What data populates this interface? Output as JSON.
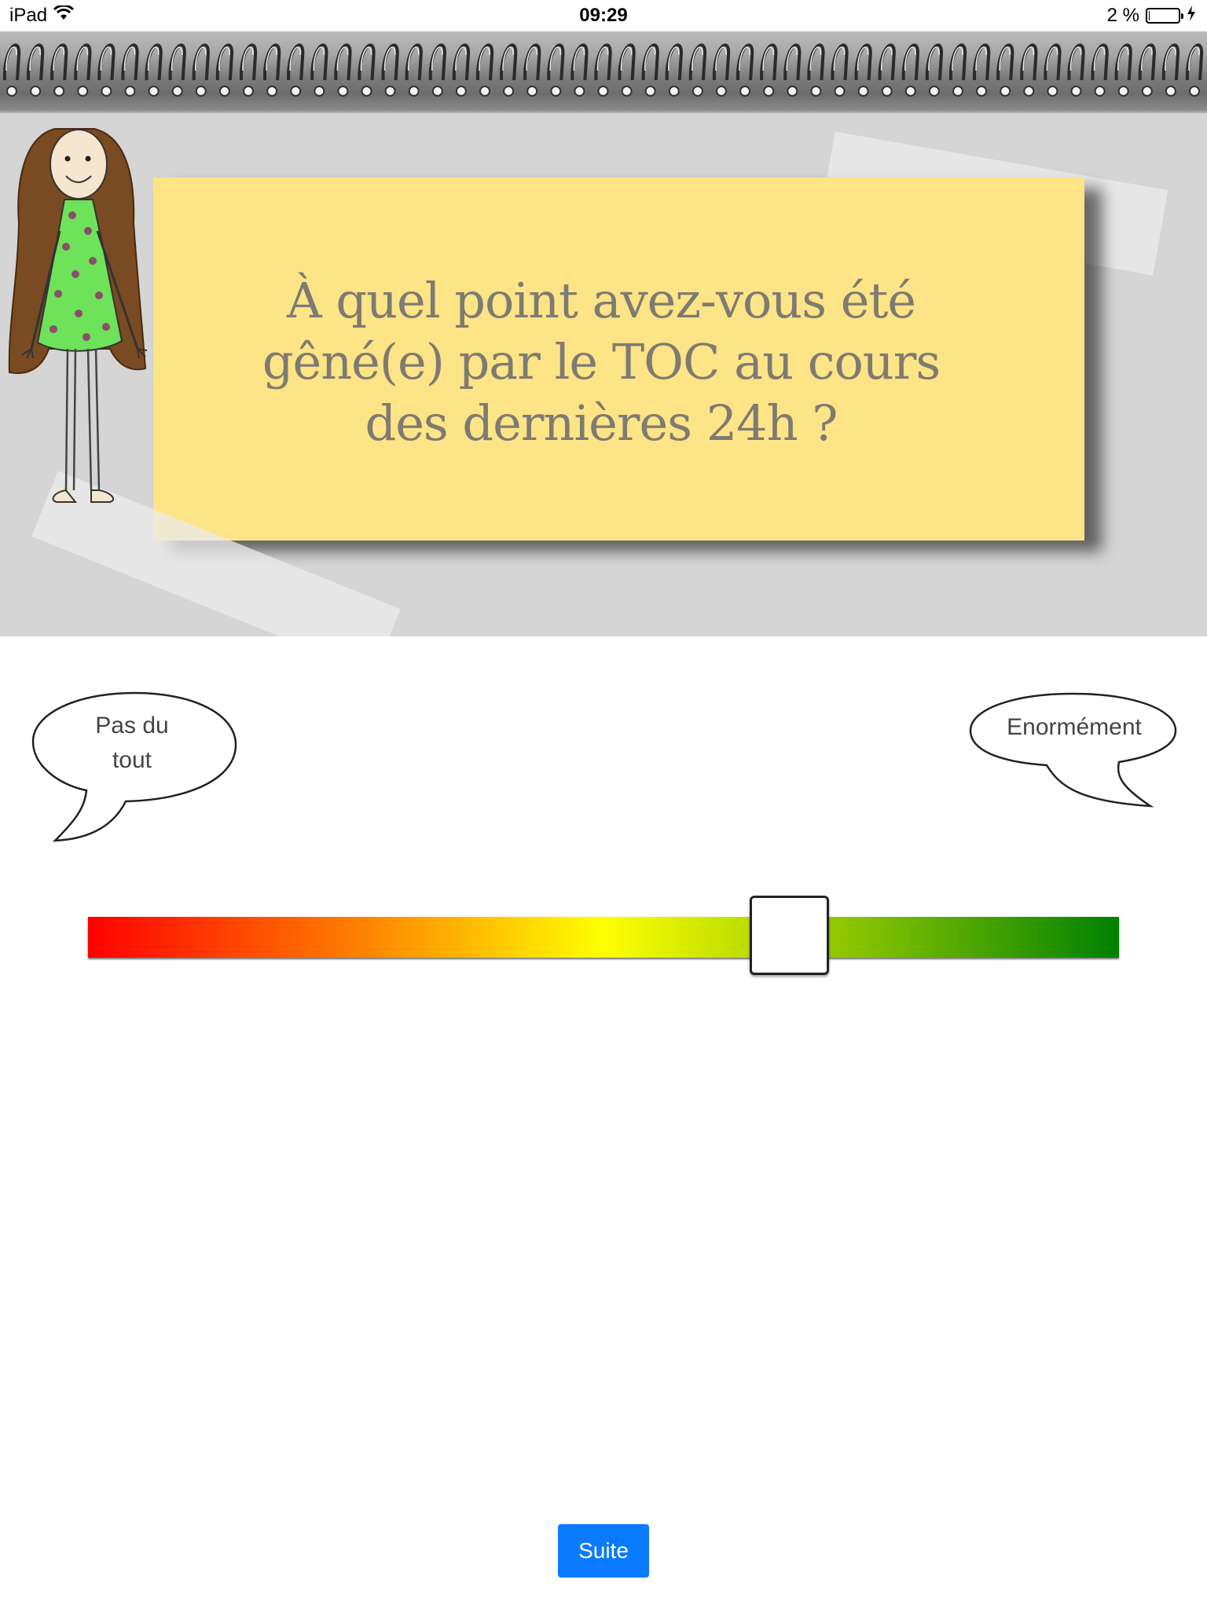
{
  "status_bar": {
    "device": "iPad",
    "time": "09:29",
    "battery": "2 %",
    "battery_level": 0.02
  },
  "question": {
    "line1": "À quel point avez-vous été",
    "line2": "gêné(e) par le TOC au cours",
    "line3": "des dernières 24h ?"
  },
  "scale": {
    "min_label_line1": "Pas du",
    "min_label_line2": "tout",
    "max_label": "Enormément",
    "value": 0.68,
    "colors": [
      "#ff0000",
      "#ff7a00",
      "#ffff00",
      "#86c200",
      "#008000"
    ]
  },
  "footer": {
    "next_label": "Suite"
  }
}
